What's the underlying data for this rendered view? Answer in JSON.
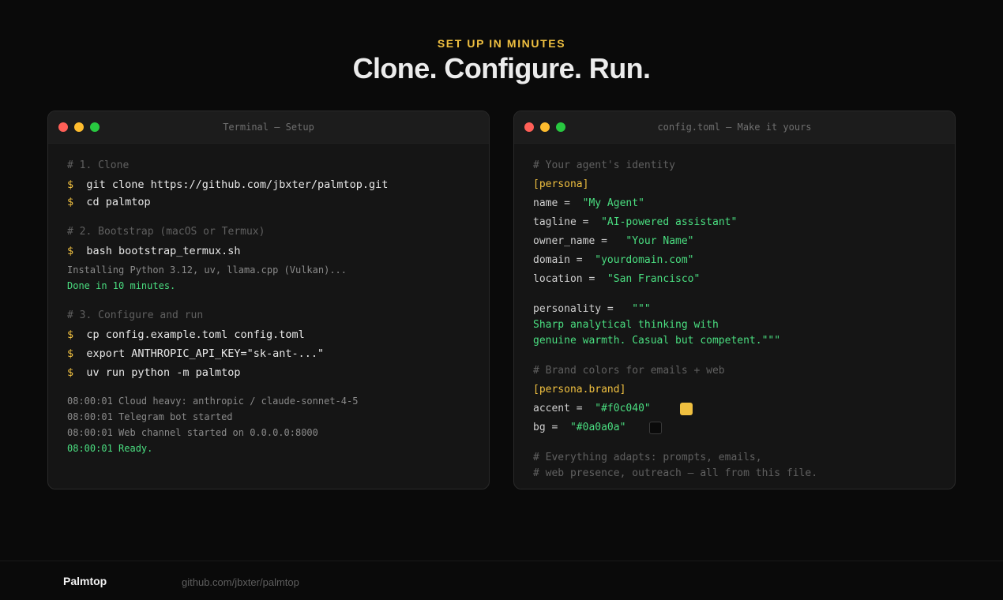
{
  "header": {
    "eyebrow": "SET UP IN MINUTES",
    "title": "Clone. Configure. Run."
  },
  "terminal": {
    "title": "Terminal — Setup",
    "lines": {
      "c1": "# 1. Clone",
      "cmd1": "git clone https://github.com/jbxter/palmtop.git",
      "cmd2": "cd palmtop",
      "c2": "# 2. Bootstrap (macOS or Termux)",
      "cmd3": "bash bootstrap_termux.sh",
      "out1": "Installing Python 3.12, uv, llama.cpp (Vulkan)...",
      "ok1": "Done in 10 minutes.",
      "c3": "# 3. Configure and run",
      "cmd4": "cp config.example.toml config.toml",
      "cmd5": "export ANTHROPIC_API_KEY=\"sk-ant-...\"",
      "cmd6": "uv run python -m palmtop",
      "log1": "08:00:01 Cloud heavy: anthropic / claude-sonnet-4-5",
      "log2": "08:00:01 Telegram bot started",
      "log3": "08:00:01 Web channel started on 0.0.0.0:8000",
      "log4": "08:00:01 Ready."
    },
    "prompt_symbol": "$"
  },
  "config": {
    "title": "config.toml — Make it yours",
    "identity_comment": "# Your agent's identity",
    "persona_section": "[persona]",
    "fields": {
      "name_key": "name = ",
      "name_val": "\"My Agent\"",
      "tagline_key": "tagline = ",
      "tagline_val": "\"AI-powered assistant\"",
      "owner_key": "owner_name = ",
      "owner_val": "\"Your Name\"",
      "domain_key": "domain = ",
      "domain_val": "\"yourdomain.com\"",
      "location_key": "location = ",
      "location_val": "\"San Francisco\"",
      "personality_key": "personality = ",
      "personality_open": "\"\"\"",
      "personality_l1": "Sharp analytical thinking with",
      "personality_l2": "genuine warmth. Casual but competent.\"\"\""
    },
    "brand_comment": "# Brand colors for emails + web",
    "brand_section": "[persona.brand]",
    "brand": {
      "accent_key": "accent = ",
      "accent_val": "\"#f0c040\"",
      "accent_color": "#f0c040",
      "bg_key": "bg = ",
      "bg_val": "\"#0a0a0a\"",
      "bg_color": "#0a0a0a"
    },
    "footer_comment_1": "# Everything adapts: prompts, emails,",
    "footer_comment_2": "# web presence, outreach — all from this file."
  },
  "footer": {
    "brand": "Palmtop",
    "repo": "github.com/jbxter/palmtop"
  }
}
